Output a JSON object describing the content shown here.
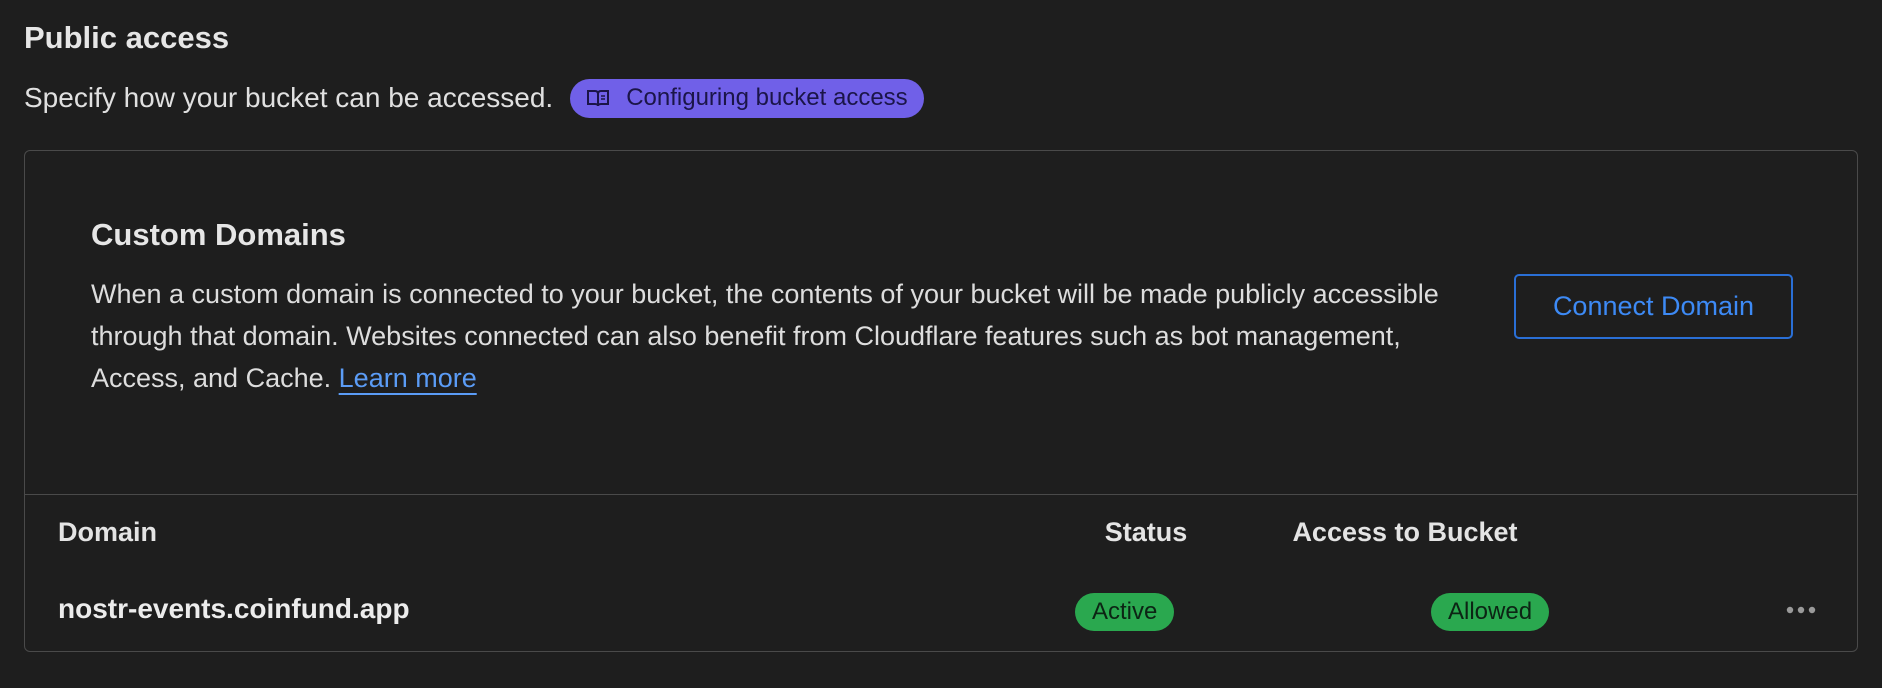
{
  "section": {
    "title": "Public access",
    "subtitle": "Specify how your bucket can be accessed.",
    "doc_link": {
      "label": "Configuring bucket access",
      "icon": "book-icon"
    }
  },
  "custom_domains": {
    "title": "Custom Domains",
    "description": "When a custom domain is connected to your bucket, the contents of your bucket will be made publicly accessible through that domain. Websites connected can also benefit from Cloudflare features such as bot management, Access, and Cache.",
    "learn_more_label": "Learn more",
    "connect_button_label": "Connect Domain"
  },
  "table": {
    "columns": [
      "Domain",
      "Status",
      "Access to Bucket"
    ],
    "rows": [
      {
        "domain": "nostr-events.coinfund.app",
        "status": "Active",
        "access": "Allowed",
        "menu_icon": "more-horizontal-icon"
      }
    ]
  },
  "colors": {
    "background": "#1e1e1e",
    "accent_pill": "#7060e8",
    "link": "#5b9cf6",
    "button_border": "#2a6fd6",
    "badge_green": "#2aa84f"
  }
}
